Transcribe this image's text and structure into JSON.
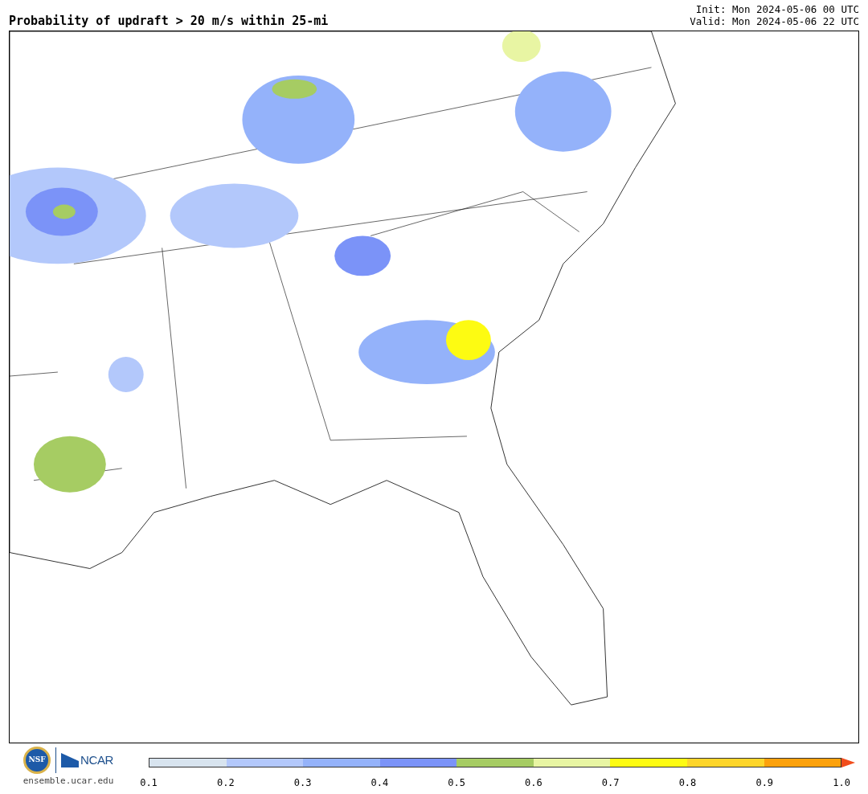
{
  "title": "Probability of updraft > 20 m/s within 25-mi",
  "init": "Init: Mon 2024-05-06 00 UTC",
  "valid": "Valid: Mon 2024-05-06 22 UTC",
  "footer": {
    "logo_text": "NSF",
    "brand": "NCAR",
    "site": "ensemble.ucar.edu"
  },
  "colorbar": {
    "bins": [
      {
        "color": "#d8e4ef"
      },
      {
        "color": "#b3c8fb"
      },
      {
        "color": "#94b2fa"
      },
      {
        "color": "#7b93f8"
      },
      {
        "color": "#a6cc63"
      },
      {
        "color": "#e8f5a3"
      },
      {
        "color": "#fdfb12"
      },
      {
        "color": "#fdd52a"
      },
      {
        "color": "#fca10c"
      }
    ],
    "extend": {
      "color": "#f14d1c"
    },
    "ticks": [
      "0.1",
      "0.2",
      "0.3",
      "0.4",
      "0.5",
      "0.6",
      "0.7",
      "0.8",
      "0.9",
      "1.0"
    ]
  }
}
